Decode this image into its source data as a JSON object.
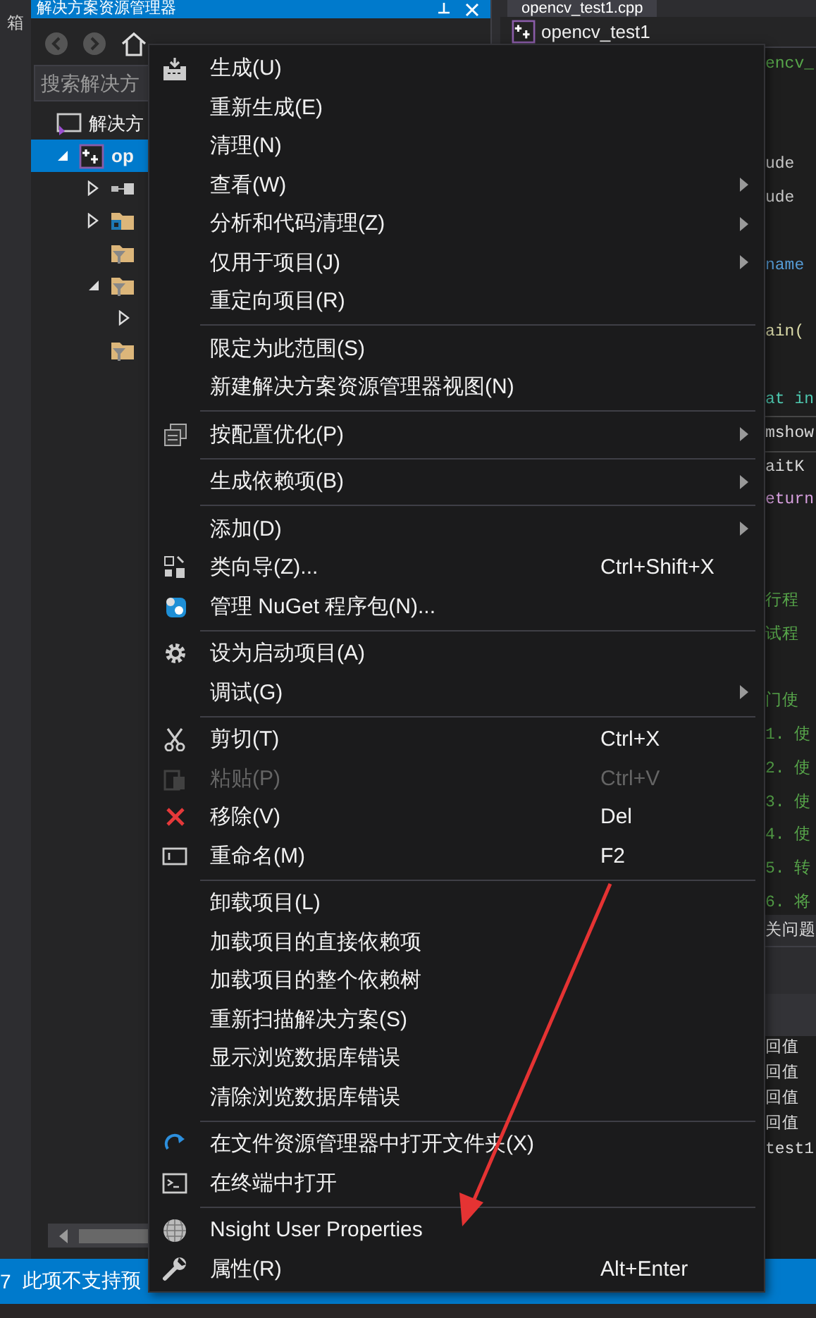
{
  "toolbox_strip": {
    "label": "箱"
  },
  "solution_explorer": {
    "title": "解决方案资源管理器",
    "search": {
      "placeholder": "搜索解决方"
    },
    "tree": [
      {
        "label": "解决方",
        "kind": "solution",
        "selected": false,
        "children": [
          {
            "label": "op",
            "kind": "project",
            "selected": true,
            "expanded": true,
            "children": [
              {
                "kind": "references",
                "selected": false,
                "expanded": false
              },
              {
                "kind": "external",
                "selected": false,
                "expanded": false
              },
              {
                "kind": "filter",
                "selected": false
              },
              {
                "kind": "filter",
                "selected": false,
                "expanded": true,
                "children": [
                  {
                    "selected": false,
                    "expanded": false
                  }
                ]
              },
              {
                "kind": "filter",
                "selected": false
              }
            ]
          }
        ]
      }
    ]
  },
  "editor": {
    "tab": {
      "label": "opencv_test1.cpp",
      "selected": true
    },
    "project_dropdown": "opencv_test1",
    "code_blocks": [
      [
        {
          "text": "encv_",
          "color": "#57a64a",
          "current": false
        }
      ],
      [
        {
          "text": "ude",
          "color": "#c8c8c8",
          "current": false
        },
        {
          "text": "ude",
          "color": "#c8c8c8",
          "current": false
        }
      ],
      [
        {
          "text": "name",
          "color": "#569cd6",
          "current": false
        }
      ],
      [
        {
          "text": "ain(",
          "color": "#dcdcaa",
          "current": false
        }
      ],
      [
        {
          "text": "at in",
          "color": "#4ec9b0",
          "current": false
        },
        {
          "text": "mshow",
          "color": "#dcdcdc",
          "current": true
        },
        {
          "text": "aitK",
          "color": "#dcdcdc",
          "current": false
        },
        {
          "text": "eturn",
          "color": "#d8a0df",
          "current": false
        }
      ],
      [
        {
          "text": "行程",
          "color": "#57a64a",
          "current": false
        },
        {
          "text": "试程",
          "color": "#57a64a",
          "current": false
        }
      ],
      [
        {
          "text": "门使",
          "color": "#57a64a",
          "current": false
        },
        {
          "text": "1. 使",
          "color": "#57a64a",
          "current": false
        },
        {
          "text": "2. 使",
          "color": "#57a64a",
          "current": false
        },
        {
          "text": "3. 使",
          "color": "#57a64a",
          "current": false
        },
        {
          "text": "4. 使",
          "color": "#57a64a",
          "current": false
        },
        {
          "text": "5. 转",
          "color": "#57a64a",
          "current": false
        },
        {
          "text": "6. 将",
          "color": "#57a64a",
          "current": false
        }
      ]
    ],
    "output": {
      "tab": "关问题",
      "lines": [
        "回值",
        "回值",
        "回值",
        "回值",
        "test1"
      ]
    }
  },
  "context_menu": [
    {
      "kind": "item",
      "label": "生成(U)",
      "submenu": false,
      "disabled": false
    },
    {
      "kind": "item",
      "label": "重新生成(E)",
      "submenu": false,
      "disabled": false
    },
    {
      "kind": "item",
      "label": "清理(N)",
      "submenu": false,
      "disabled": false
    },
    {
      "kind": "item",
      "label": "查看(W)",
      "submenu": true,
      "disabled": false
    },
    {
      "kind": "item",
      "label": "分析和代码清理(Z)",
      "submenu": true,
      "disabled": false
    },
    {
      "kind": "item",
      "label": "仅用于项目(J)",
      "submenu": true,
      "disabled": false
    },
    {
      "kind": "item",
      "label": "重定向项目(R)",
      "submenu": false,
      "disabled": false
    },
    {
      "kind": "separator"
    },
    {
      "kind": "item",
      "label": "限定为此范围(S)",
      "submenu": false,
      "disabled": false
    },
    {
      "kind": "item",
      "label": "新建解决方案资源管理器视图(N)",
      "submenu": false,
      "disabled": false
    },
    {
      "kind": "separator"
    },
    {
      "kind": "item",
      "label": "按配置优化(P)",
      "submenu": true,
      "disabled": false
    },
    {
      "kind": "separator"
    },
    {
      "kind": "item",
      "label": "生成依赖项(B)",
      "submenu": true,
      "disabled": false
    },
    {
      "kind": "separator"
    },
    {
      "kind": "item",
      "label": "添加(D)",
      "submenu": true,
      "disabled": false
    },
    {
      "kind": "item",
      "label": "类向导(Z)...",
      "shortcut": "Ctrl+Shift+X",
      "submenu": false,
      "disabled": false
    },
    {
      "kind": "item",
      "label": "管理 NuGet 程序包(N)...",
      "submenu": false,
      "disabled": false
    },
    {
      "kind": "separator"
    },
    {
      "kind": "item",
      "label": "设为启动项目(A)",
      "submenu": false,
      "disabled": false
    },
    {
      "kind": "item",
      "label": "调试(G)",
      "submenu": true,
      "disabled": false
    },
    {
      "kind": "separator"
    },
    {
      "kind": "item",
      "label": "剪切(T)",
      "shortcut": "Ctrl+X",
      "submenu": false,
      "disabled": false
    },
    {
      "kind": "item",
      "label": "粘贴(P)",
      "shortcut": "Ctrl+V",
      "submenu": false,
      "disabled": true
    },
    {
      "kind": "item",
      "label": "移除(V)",
      "shortcut": "Del",
      "submenu": false,
      "disabled": false
    },
    {
      "kind": "item",
      "label": "重命名(M)",
      "shortcut": "F2",
      "submenu": false,
      "disabled": false
    },
    {
      "kind": "separator"
    },
    {
      "kind": "item",
      "label": "卸载项目(L)",
      "submenu": false,
      "disabled": false
    },
    {
      "kind": "item",
      "label": "加载项目的直接依赖项",
      "submenu": false,
      "disabled": false
    },
    {
      "kind": "item",
      "label": "加载项目的整个依赖树",
      "submenu": false,
      "disabled": false
    },
    {
      "kind": "item",
      "label": "重新扫描解决方案(S)",
      "submenu": false,
      "disabled": false
    },
    {
      "kind": "item",
      "label": "显示浏览数据库错误",
      "submenu": false,
      "disabled": false
    },
    {
      "kind": "item",
      "label": "清除浏览数据库错误",
      "submenu": false,
      "disabled": false
    },
    {
      "kind": "separator"
    },
    {
      "kind": "item",
      "label": "在文件资源管理器中打开文件夹(X)",
      "submenu": false,
      "disabled": false
    },
    {
      "kind": "item",
      "label": "在终端中打开",
      "submenu": false,
      "disabled": false
    },
    {
      "kind": "separator"
    },
    {
      "kind": "item",
      "label": "Nsight User Properties",
      "submenu": false,
      "disabled": false
    },
    {
      "kind": "item",
      "label": "属性(R)",
      "shortcut": "Alt+Enter",
      "submenu": false,
      "disabled": false
    }
  ],
  "status_bar": {
    "items": [
      "7",
      "此项不支持预"
    ]
  }
}
